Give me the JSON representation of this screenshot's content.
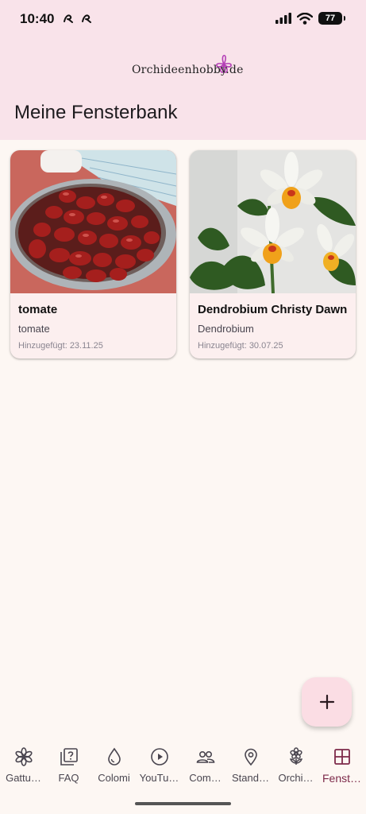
{
  "status_bar": {
    "time": "10:40",
    "battery": "77"
  },
  "header": {
    "logo_text": "Orchideenhobby.de",
    "title": "Meine Fensterbank"
  },
  "plants": [
    {
      "name": "tomate",
      "genus": "tomate",
      "added": "Hinzugefügt: 23.11.25"
    },
    {
      "name": "Dendrobium Christy Dawn",
      "genus": "Dendrobium",
      "added": "Hinzugefügt: 30.07.25"
    }
  ],
  "fab": {
    "icon": "plus-icon"
  },
  "nav": {
    "items": [
      {
        "label": "Gattu…",
        "icon": "flower-star-icon"
      },
      {
        "label": "FAQ",
        "icon": "help-box-icon"
      },
      {
        "label": "Colomi",
        "icon": "drop-icon"
      },
      {
        "label": "YouTu…",
        "icon": "play-circle-icon"
      },
      {
        "label": "Com…",
        "icon": "people-icon"
      },
      {
        "label": "Stand…",
        "icon": "location-pin-icon"
      },
      {
        "label": "Orchi…",
        "icon": "orchid-icon"
      },
      {
        "label": "Fenst…",
        "icon": "window-grid-icon"
      }
    ],
    "active": "Fenst…"
  },
  "colors": {
    "header_bg": "#f9e3ea",
    "page_bg": "#fdf7f3",
    "card_bg": "#fcefef",
    "accent": "#7d2a4a",
    "fab_bg": "#fbdde4"
  }
}
